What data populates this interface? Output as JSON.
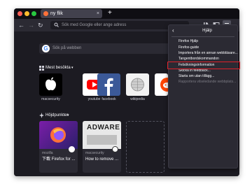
{
  "browser": {
    "tab": {
      "title": "ny flik",
      "close_glyph": "×"
    },
    "new_tab_glyph": "+",
    "toolbar": {
      "back_glyph": "←",
      "forward_glyph": "→",
      "reload_glyph": "↻"
    },
    "urlbar": {
      "placeholder": "Sök med Google eller ange adress",
      "icon": "search-icon"
    }
  },
  "newtab": {
    "search": {
      "placeholder": "Sök på webben",
      "logo_letter": "G"
    },
    "top_sites": {
      "heading": "Mest besökta",
      "items": [
        {
          "label": "macsecurity",
          "color": "#000000"
        },
        {
          "label": "youtube",
          "color": "#ffffff"
        },
        {
          "label": "facebook",
          "color": "#3b5998"
        },
        {
          "label": "wikipedia",
          "color": "#f2f2f2"
        },
        {
          "label": "reddit",
          "color": "#ffffff"
        }
      ]
    },
    "highlights": {
      "heading": "Höjdpunkter",
      "cards": [
        {
          "source": "mozilla",
          "title": "下載 Firefox for ..."
        },
        {
          "source": "macsecurity",
          "title": "How to remove ...",
          "image_text": "ADWARE"
        }
      ]
    }
  },
  "help_menu": {
    "back_glyph": "‹",
    "title": "Hjälp",
    "items": [
      {
        "label": "Firefox Hjälp",
        "disabled": false
      },
      {
        "label": "Firefox-guide",
        "disabled": false
      },
      {
        "label": "Importera från en annan webbläsare...",
        "disabled": false
      },
      {
        "label": "Tangentbordskommandon",
        "disabled": false
      },
      {
        "label": "Felsökningsinformation",
        "disabled": false
      },
      {
        "label": "Skicka in feedback...",
        "disabled": false
      },
      {
        "label": "Starta om utan tillägg...",
        "disabled": false
      },
      {
        "label": "Rapportera vilseledande webbplats...",
        "disabled": true
      }
    ],
    "highlighted_item": "Felsökningsinformation"
  },
  "colors": {
    "accent": "#0060df",
    "highlight": "#e0202a",
    "menu_bg": "#2b2a33",
    "page_bg": "#1c1b22"
  }
}
